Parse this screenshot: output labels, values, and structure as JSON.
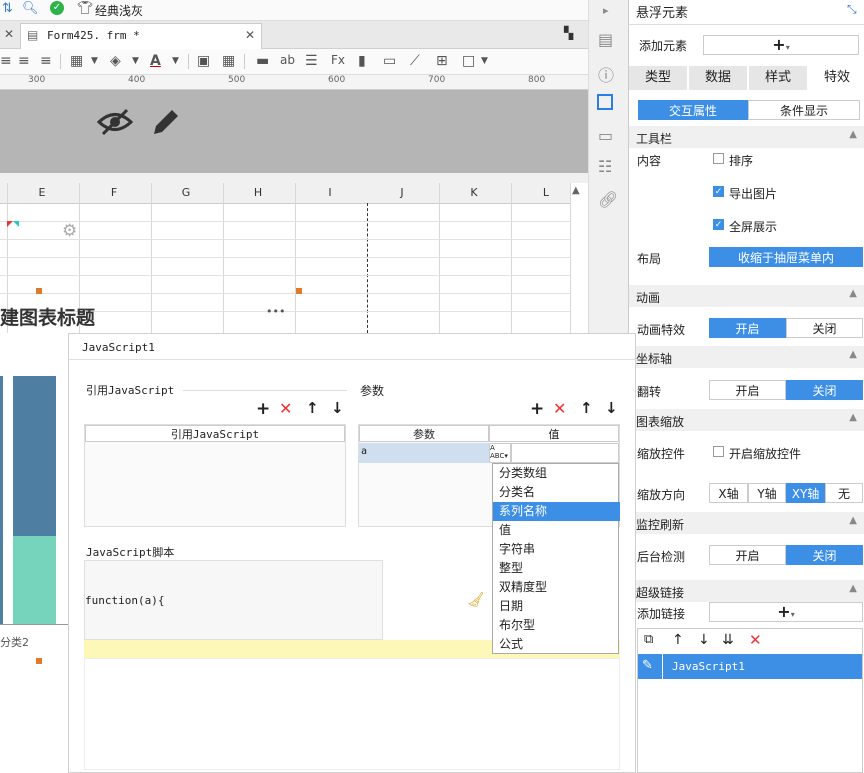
{
  "topbar": {
    "theme_label": "经典浅灰"
  },
  "tab": {
    "filename": "Form425. frm *"
  },
  "ruler": {
    "marks": [
      "300",
      "400",
      "500",
      "600",
      "700",
      "800"
    ]
  },
  "sheet": {
    "columns": [
      "E",
      "F",
      "G",
      "H",
      "I",
      "J",
      "K",
      "L"
    ],
    "chart_title": "建图表标题",
    "category_label": "分类2",
    "ellipsis": "•••"
  },
  "panel": {
    "header": "悬浮元素",
    "add_element_label": "添加元素",
    "add_element_button": "+",
    "tabs": [
      "类型",
      "数据",
      "样式",
      "特效"
    ],
    "subtabs": [
      "交互属性",
      "条件显示"
    ],
    "toolbar_section": "工具栏",
    "content_label": "内容",
    "checks": [
      {
        "label": "排序",
        "checked": false
      },
      {
        "label": "导出图片",
        "checked": true
      },
      {
        "label": "全屏展示",
        "checked": true
      }
    ],
    "layout_label": "布局",
    "layout_value": "收缩于抽屉菜单内",
    "animation_section": "动画",
    "animation_effect_label": "动画特效",
    "on": "开启",
    "off": "关闭",
    "axis_section": "坐标轴",
    "flip_label": "翻转",
    "zoom_section": "图表缩放",
    "zoom_control_label": "缩放控件",
    "zoom_control_check": "开启缩放控件",
    "zoom_dir_label": "缩放方向",
    "zoom_dirs": [
      "X轴",
      "Y轴",
      "XY轴",
      "无"
    ],
    "monitor_section": "监控刷新",
    "bg_check_label": "后台检测",
    "link_section": "超级链接",
    "add_link_label": "添加链接",
    "add_link_button": "+",
    "link_item": "JavaScript1"
  },
  "dialog": {
    "title": "JavaScript1",
    "ref_js_label": "引用JavaScript",
    "ref_js_header": "引用JavaScript",
    "params_label": "参数",
    "param_header": "参数",
    "value_header": "值",
    "param_name": "a",
    "script_label": "JavaScript脚本",
    "script_code": "function(a){",
    "type_options": [
      "分类数组",
      "分类名",
      "系列名称",
      "值",
      "字符串",
      "整型",
      "双精度型",
      "日期",
      "布尔型",
      "公式"
    ],
    "selected_type": "系列名称"
  },
  "colors": {
    "accent": "#3d8fe6",
    "bar_dark": "#4e7fa2",
    "bar_teal": "#76d3bc",
    "highlight_row": "#fdf8b8"
  }
}
